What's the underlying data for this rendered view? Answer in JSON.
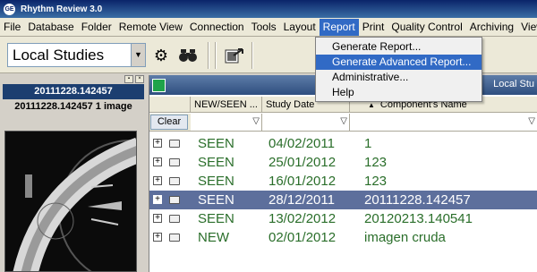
{
  "title": "Rhythm Review 3.0",
  "menu": [
    "File",
    "Database",
    "Folder",
    "Remote View",
    "Connection",
    "Tools",
    "Layout",
    "Report",
    "Print",
    "Quality Control",
    "Archiving",
    "Viewi"
  ],
  "toolbar": {
    "combo_value": "Local Studies"
  },
  "report_menu": [
    "Generate Report...",
    "Generate Advanced Report...",
    "Administrative...",
    "Help"
  ],
  "left_panel": {
    "title": "20111228.142457",
    "subtitle": "20111228.142457  1 image"
  },
  "right_panel": {
    "header_title": "Local Stu",
    "columns": [
      "NEW/SEEN ...",
      "Study Date",
      "Component's Name"
    ],
    "clear_label": "Clear",
    "rows": [
      {
        "status": "SEEN",
        "date": "04/02/2011",
        "name": "1"
      },
      {
        "status": "SEEN",
        "date": "25/01/2012",
        "name": "123"
      },
      {
        "status": "SEEN",
        "date": "16/01/2012",
        "name": "123"
      },
      {
        "status": "SEEN",
        "date": "28/12/2011",
        "name": "20111228.142457"
      },
      {
        "status": "SEEN",
        "date": "13/02/2012",
        "name": "20120213.140541"
      },
      {
        "status": "NEW",
        "date": "02/01/2012",
        "name": "imagen cruda"
      }
    ]
  },
  "colors": {
    "accent": "#316ac5",
    "status_text": "#2a6e2a",
    "selected_row": "#5d6f9c"
  }
}
